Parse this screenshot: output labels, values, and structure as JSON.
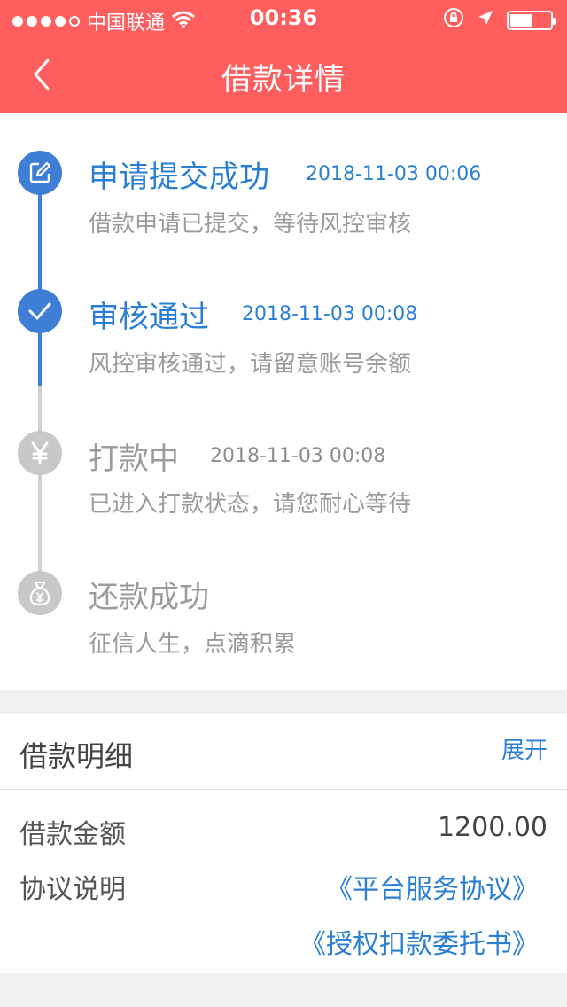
{
  "status_bar": {
    "carrier": "中国联通",
    "time": "00:36",
    "battery_level": 0.55
  },
  "nav": {
    "title": "借款详情",
    "back_icon": "chevron-left-icon"
  },
  "colors": {
    "header_bg": "#fe5e5e",
    "active_blue": "#3e7ed6",
    "link_blue": "#2a7fd4",
    "inactive_gray": "#c8c8c8"
  },
  "steps": [
    {
      "title": "申请提交成功",
      "time": "2018-11-03 00:06",
      "desc": "借款申请已提交，等待风控审核",
      "icon": "edit-icon",
      "active": true
    },
    {
      "title": "审核通过",
      "time": "2018-11-03 00:08",
      "desc": "风控审核通过，请留意账号余额",
      "icon": "check-icon",
      "active": true
    },
    {
      "title": "打款中",
      "time": "2018-11-03 00:08",
      "desc": "已进入打款状态，请您耐心等待",
      "icon": "yen-icon",
      "active": false
    },
    {
      "title": "还款成功",
      "time": "",
      "desc": "征信人生，点滴积累",
      "icon": "money-bag-icon",
      "active": false
    }
  ],
  "detail": {
    "title": "借款明细",
    "expand_label": "展开",
    "amount_label": "借款金额",
    "amount_value": "1200.00",
    "agreement_label": "协议说明",
    "agreements": [
      "《平台服务协议》",
      "《授权扣款委托书》"
    ]
  }
}
